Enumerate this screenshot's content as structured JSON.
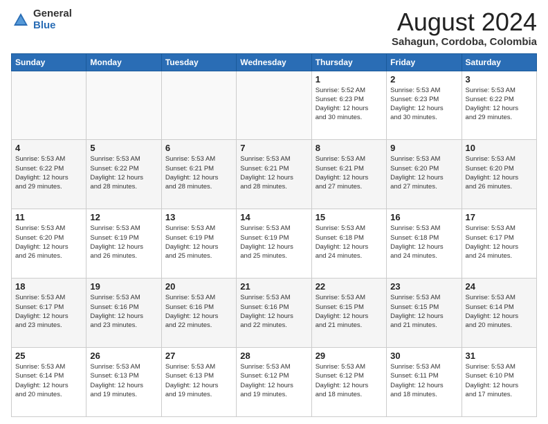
{
  "logo": {
    "general": "General",
    "blue": "Blue"
  },
  "title": "August 2024",
  "location": "Sahagun, Cordoba, Colombia",
  "days_header": [
    "Sunday",
    "Monday",
    "Tuesday",
    "Wednesday",
    "Thursday",
    "Friday",
    "Saturday"
  ],
  "weeks": [
    [
      {
        "day": "",
        "text": ""
      },
      {
        "day": "",
        "text": ""
      },
      {
        "day": "",
        "text": ""
      },
      {
        "day": "",
        "text": ""
      },
      {
        "day": "1",
        "text": "Sunrise: 5:52 AM\nSunset: 6:23 PM\nDaylight: 12 hours\nand 30 minutes."
      },
      {
        "day": "2",
        "text": "Sunrise: 5:53 AM\nSunset: 6:23 PM\nDaylight: 12 hours\nand 30 minutes."
      },
      {
        "day": "3",
        "text": "Sunrise: 5:53 AM\nSunset: 6:22 PM\nDaylight: 12 hours\nand 29 minutes."
      }
    ],
    [
      {
        "day": "4",
        "text": "Sunrise: 5:53 AM\nSunset: 6:22 PM\nDaylight: 12 hours\nand 29 minutes."
      },
      {
        "day": "5",
        "text": "Sunrise: 5:53 AM\nSunset: 6:22 PM\nDaylight: 12 hours\nand 28 minutes."
      },
      {
        "day": "6",
        "text": "Sunrise: 5:53 AM\nSunset: 6:21 PM\nDaylight: 12 hours\nand 28 minutes."
      },
      {
        "day": "7",
        "text": "Sunrise: 5:53 AM\nSunset: 6:21 PM\nDaylight: 12 hours\nand 28 minutes."
      },
      {
        "day": "8",
        "text": "Sunrise: 5:53 AM\nSunset: 6:21 PM\nDaylight: 12 hours\nand 27 minutes."
      },
      {
        "day": "9",
        "text": "Sunrise: 5:53 AM\nSunset: 6:20 PM\nDaylight: 12 hours\nand 27 minutes."
      },
      {
        "day": "10",
        "text": "Sunrise: 5:53 AM\nSunset: 6:20 PM\nDaylight: 12 hours\nand 26 minutes."
      }
    ],
    [
      {
        "day": "11",
        "text": "Sunrise: 5:53 AM\nSunset: 6:20 PM\nDaylight: 12 hours\nand 26 minutes."
      },
      {
        "day": "12",
        "text": "Sunrise: 5:53 AM\nSunset: 6:19 PM\nDaylight: 12 hours\nand 26 minutes."
      },
      {
        "day": "13",
        "text": "Sunrise: 5:53 AM\nSunset: 6:19 PM\nDaylight: 12 hours\nand 25 minutes."
      },
      {
        "day": "14",
        "text": "Sunrise: 5:53 AM\nSunset: 6:19 PM\nDaylight: 12 hours\nand 25 minutes."
      },
      {
        "day": "15",
        "text": "Sunrise: 5:53 AM\nSunset: 6:18 PM\nDaylight: 12 hours\nand 24 minutes."
      },
      {
        "day": "16",
        "text": "Sunrise: 5:53 AM\nSunset: 6:18 PM\nDaylight: 12 hours\nand 24 minutes."
      },
      {
        "day": "17",
        "text": "Sunrise: 5:53 AM\nSunset: 6:17 PM\nDaylight: 12 hours\nand 24 minutes."
      }
    ],
    [
      {
        "day": "18",
        "text": "Sunrise: 5:53 AM\nSunset: 6:17 PM\nDaylight: 12 hours\nand 23 minutes."
      },
      {
        "day": "19",
        "text": "Sunrise: 5:53 AM\nSunset: 6:16 PM\nDaylight: 12 hours\nand 23 minutes."
      },
      {
        "day": "20",
        "text": "Sunrise: 5:53 AM\nSunset: 6:16 PM\nDaylight: 12 hours\nand 22 minutes."
      },
      {
        "day": "21",
        "text": "Sunrise: 5:53 AM\nSunset: 6:16 PM\nDaylight: 12 hours\nand 22 minutes."
      },
      {
        "day": "22",
        "text": "Sunrise: 5:53 AM\nSunset: 6:15 PM\nDaylight: 12 hours\nand 21 minutes."
      },
      {
        "day": "23",
        "text": "Sunrise: 5:53 AM\nSunset: 6:15 PM\nDaylight: 12 hours\nand 21 minutes."
      },
      {
        "day": "24",
        "text": "Sunrise: 5:53 AM\nSunset: 6:14 PM\nDaylight: 12 hours\nand 20 minutes."
      }
    ],
    [
      {
        "day": "25",
        "text": "Sunrise: 5:53 AM\nSunset: 6:14 PM\nDaylight: 12 hours\nand 20 minutes."
      },
      {
        "day": "26",
        "text": "Sunrise: 5:53 AM\nSunset: 6:13 PM\nDaylight: 12 hours\nand 19 minutes."
      },
      {
        "day": "27",
        "text": "Sunrise: 5:53 AM\nSunset: 6:13 PM\nDaylight: 12 hours\nand 19 minutes."
      },
      {
        "day": "28",
        "text": "Sunrise: 5:53 AM\nSunset: 6:12 PM\nDaylight: 12 hours\nand 19 minutes."
      },
      {
        "day": "29",
        "text": "Sunrise: 5:53 AM\nSunset: 6:12 PM\nDaylight: 12 hours\nand 18 minutes."
      },
      {
        "day": "30",
        "text": "Sunrise: 5:53 AM\nSunset: 6:11 PM\nDaylight: 12 hours\nand 18 minutes."
      },
      {
        "day": "31",
        "text": "Sunrise: 5:53 AM\nSunset: 6:10 PM\nDaylight: 12 hours\nand 17 minutes."
      }
    ]
  ]
}
